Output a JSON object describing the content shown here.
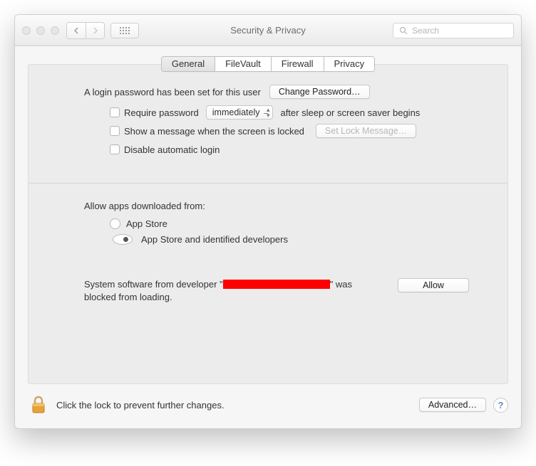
{
  "title": "Security & Privacy",
  "search_placeholder": "Search",
  "tabs": {
    "general": "General",
    "filevault": "FileVault",
    "firewall": "Firewall",
    "privacy": "Privacy"
  },
  "login": {
    "heading": "A login password has been set for this user",
    "change_btn": "Change Password…",
    "require_label_pre": "Require password",
    "require_select": "immediately",
    "require_label_post": "after sleep or screen saver begins",
    "show_msg_label": "Show a message when the screen is locked",
    "set_lock_btn": "Set Lock Message…",
    "disable_auto_label": "Disable automatic login"
  },
  "allow": {
    "heading": "Allow apps downloaded from:",
    "opt1": "App Store",
    "opt2": "App Store and identified developers"
  },
  "blocked": {
    "pre": "System software from developer \"",
    "post": "\" was blocked from loading.",
    "allow_btn": "Allow"
  },
  "footer": {
    "lock_text": "Click the lock to prevent further changes.",
    "advanced_btn": "Advanced…",
    "help": "?"
  }
}
